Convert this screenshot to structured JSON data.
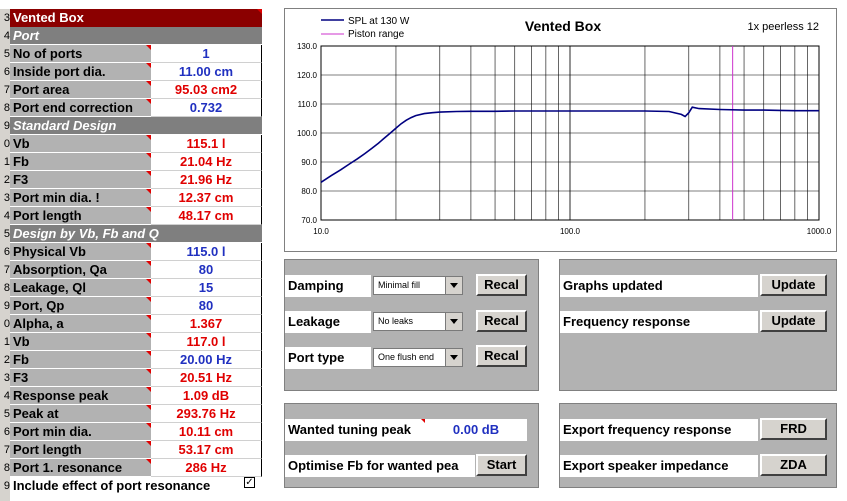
{
  "title": "Vented Box",
  "row_numbers": [
    "3",
    "4",
    "5",
    "6",
    "7",
    "8",
    "9",
    "0",
    "1",
    "2",
    "3",
    "4",
    "5",
    "6",
    "7",
    "8",
    "9",
    "0",
    "1",
    "2",
    "3",
    "4",
    "5",
    "6",
    "7",
    "8",
    "9"
  ],
  "port_section": {
    "header": "Port",
    "rows": [
      {
        "label": "No of ports",
        "value": "1",
        "color": "blue"
      },
      {
        "label": "Inside port dia.",
        "value": "11.00 cm",
        "color": "blue"
      },
      {
        "label": "Port area",
        "value": "95.03 cm2",
        "color": "red"
      },
      {
        "label": "Port end correction",
        "value": "0.732",
        "color": "blue"
      }
    ]
  },
  "standard_section": {
    "header": "Standard Design",
    "rows": [
      {
        "label": "Vb",
        "value": "115.1 l",
        "color": "red"
      },
      {
        "label": "Fb",
        "value": "21.04 Hz",
        "color": "red"
      },
      {
        "label": "F3",
        "value": "21.96 Hz",
        "color": "red"
      },
      {
        "label": "Port min dia. !",
        "value": "12.37 cm",
        "color": "red"
      },
      {
        "label": "Port length",
        "value": "48.17 cm",
        "color": "red"
      }
    ]
  },
  "design_section": {
    "header": "Design by Vb, Fb and Q",
    "rows": [
      {
        "label": "Physical Vb",
        "value": "115.0 l",
        "color": "blue"
      },
      {
        "label": "Absorption, Qa",
        "value": "80",
        "color": "blue"
      },
      {
        "label": "Leakage, Ql",
        "value": "15",
        "color": "blue"
      },
      {
        "label": "Port, Qp",
        "value": "80",
        "color": "blue"
      },
      {
        "label": "Alpha, a",
        "value": "1.367",
        "color": "red"
      },
      {
        "label": "Vb",
        "value": "117.0 l",
        "color": "red"
      },
      {
        "label": "Fb",
        "value": "20.00 Hz",
        "color": "blue"
      },
      {
        "label": "F3",
        "value": "20.51 Hz",
        "color": "red"
      },
      {
        "label": "Response peak",
        "value": "1.09 dB",
        "color": "red"
      },
      {
        "label": "Peak at",
        "value": "293.76 Hz",
        "color": "red"
      },
      {
        "label": "Port min dia.",
        "value": "10.11 cm",
        "color": "red"
      },
      {
        "label": "Port length",
        "value": "53.17 cm",
        "color": "red"
      },
      {
        "label": "Port 1. resonance",
        "value": "286 Hz",
        "color": "red"
      }
    ]
  },
  "include_resonance": {
    "label": "Include effect of port resonance",
    "checked": "✓"
  },
  "controls": {
    "damping": {
      "label": "Damping",
      "selected": "Minimal fill",
      "button": "Recal"
    },
    "leakage": {
      "label": "Leakage",
      "selected": "No leaks",
      "button": "Recal"
    },
    "port_type": {
      "label": "Port type",
      "selected": "One flush end",
      "button": "Recal"
    },
    "graphs_updated": {
      "label": "Graphs updated",
      "button": "Update"
    },
    "freq_response": {
      "label": "Frequency response",
      "button": "Update"
    },
    "wanted_tuning": {
      "label": "Wanted tuning peak",
      "value": "0.00 dB"
    },
    "optimise": {
      "label": "Optimise Fb for wanted pea",
      "button": "Start"
    },
    "export_frd": {
      "label": "Export frequency response",
      "button": "FRD"
    },
    "export_zda": {
      "label": "Export speaker impedance",
      "button": "ZDA"
    }
  },
  "chart_data": {
    "type": "line",
    "title": "Vented Box",
    "subtitle": "1x peerless 12",
    "xscale": "log",
    "xlim": [
      10,
      1000
    ],
    "ylim": [
      70,
      130
    ],
    "xticks": [
      "10.0",
      "100.0",
      "1000.0"
    ],
    "yticks": [
      "70.0",
      "80.0",
      "90.0",
      "100.0",
      "110.0",
      "120.0",
      "130.0"
    ],
    "grid": true,
    "legend_placement": "top-left",
    "series": [
      {
        "name": "SPL at 130 W",
        "color": "#000080",
        "x": [
          10,
          11,
          12,
          13,
          14,
          15,
          16,
          17,
          18,
          19,
          20,
          21,
          22,
          23,
          24,
          26,
          28,
          30,
          35,
          40,
          50,
          60,
          80,
          100,
          150,
          200,
          250,
          280,
          290,
          300,
          310,
          330,
          400,
          500,
          600,
          700,
          800,
          900,
          1000
        ],
        "y": [
          83.0,
          85.3,
          87.3,
          89.3,
          91.1,
          92.9,
          94.7,
          96.5,
          98.3,
          100.0,
          101.7,
          103.2,
          104.4,
          105.3,
          106.0,
          106.7,
          107.0,
          107.2,
          107.4,
          107.5,
          107.5,
          107.6,
          107.6,
          107.6,
          107.6,
          107.6,
          107.4,
          106.4,
          105.7,
          107.0,
          108.9,
          108.4,
          108.1,
          107.9,
          107.9,
          107.8,
          107.7,
          107.7,
          107.7
        ]
      },
      {
        "name": "Piston range",
        "color": "#cc33cc",
        "x": [
          450,
          450
        ],
        "y": [
          70,
          130
        ]
      }
    ]
  }
}
